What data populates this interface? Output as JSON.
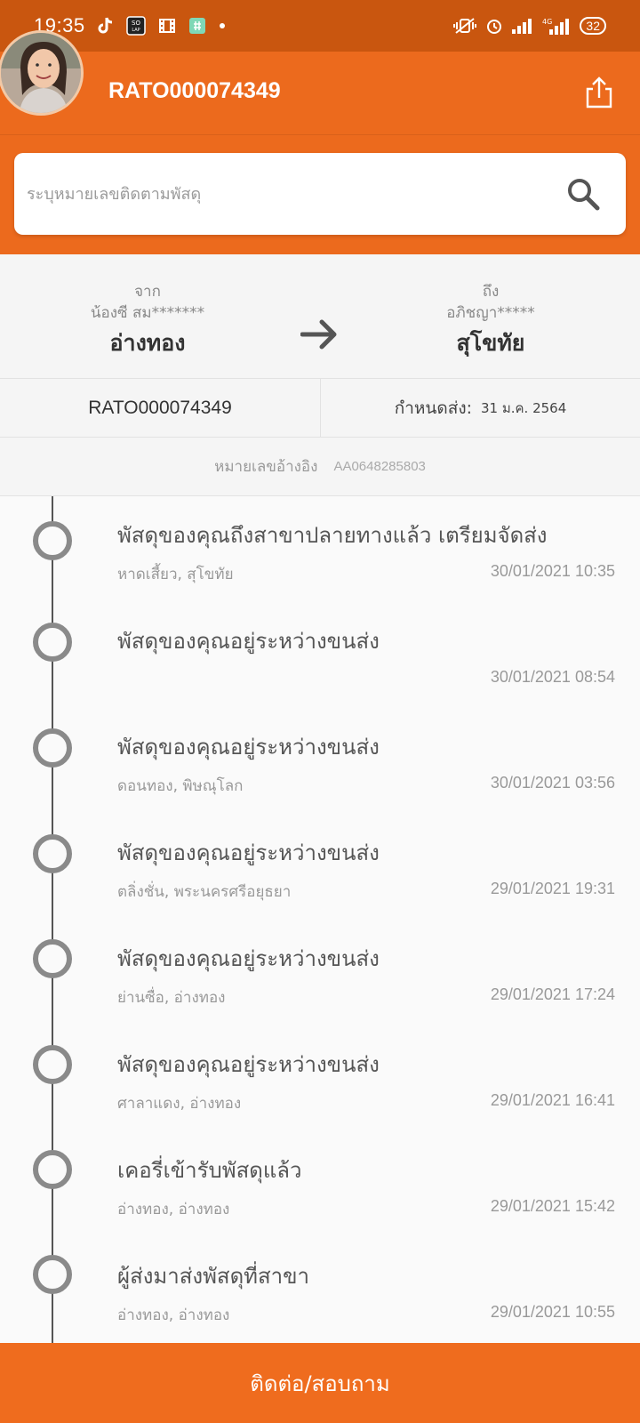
{
  "status_bar": {
    "time": "19:35",
    "battery": "32",
    "network": "4G",
    "left_icons": [
      "tiktok-icon",
      "solitaire-icon",
      "film-icon",
      "app-icon",
      "dot-icon"
    ],
    "right_icons": [
      "vibrate-icon",
      "alarm-icon",
      "signal-icon",
      "signal-4g-icon",
      "battery-icon"
    ]
  },
  "header": {
    "title": "RATO000074349",
    "share_icon": "share-icon",
    "color": "#ec6a1d"
  },
  "search": {
    "placeholder": "ระบุหมายเลขติดตามพัสดุ",
    "value": ""
  },
  "route": {
    "from_label": "จาก",
    "from_name": "น้องซี สม*******",
    "from_city": "อ่างทอง",
    "to_label": "ถึง",
    "to_name": "อภิชญา*****",
    "to_city": "สุโขทัย"
  },
  "info": {
    "tracking": "RATO000074349",
    "due_label": "กำหนดส่ง:",
    "due_value": "31 ม.ค. 2564"
  },
  "reference": {
    "label": "หมายเลขอ้างอิง",
    "value": "AA0648285803"
  },
  "events": [
    {
      "status": "พัสดุของคุณถึงสาขาปลายทางแล้ว เตรียมจัดส่ง",
      "location": "หาดเสี้ยว, สุโขทัย",
      "time": "30/01/2021 10:35"
    },
    {
      "status": "พัสดุของคุณอยู่ระหว่างขนส่ง",
      "location": "",
      "time": "30/01/2021 08:54"
    },
    {
      "status": "พัสดุของคุณอยู่ระหว่างขนส่ง",
      "location": "ดอนทอง, พิษณุโลก",
      "time": "30/01/2021 03:56"
    },
    {
      "status": "พัสดุของคุณอยู่ระหว่างขนส่ง",
      "location": "ตลิ่งชั่น, พระนครศรีอยุธยา",
      "time": "29/01/2021 19:31"
    },
    {
      "status": "พัสดุของคุณอยู่ระหว่างขนส่ง",
      "location": "ย่านซื่อ, อ่างทอง",
      "time": "29/01/2021 17:24"
    },
    {
      "status": "พัสดุของคุณอยู่ระหว่างขนส่ง",
      "location": "ศาลาแดง, อ่างทอง",
      "time": "29/01/2021 16:41"
    },
    {
      "status": "เคอรี่เข้ารับพัสดุแล้ว",
      "location": "อ่างทอง, อ่างทอง",
      "time": "29/01/2021 15:42"
    },
    {
      "status": "ผู้ส่งมาส่งพัสดุที่สาขา",
      "location": "อ่างทอง, อ่างทอง",
      "time": "29/01/2021 10:55"
    }
  ],
  "bottom_button": {
    "label": "ติดต่อ/สอบถาม",
    "color": "#ef6c1e"
  }
}
